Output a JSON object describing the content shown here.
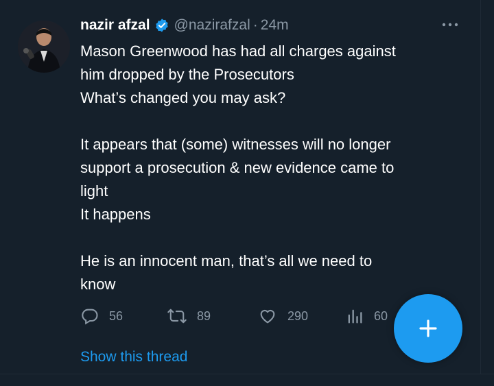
{
  "tweet": {
    "display_name": "nazir afzal",
    "handle": "@nazirafzal",
    "separator": "·",
    "time": "24m",
    "text": "Mason Greenwood has had all charges against\nhim dropped by the Prosecutors\nWhat’s changed you may ask?\n\nIt appears that (some) witnesses will no longer\nsupport a prosecution & new evidence came to\nlight\nIt happens\n\nHe is an innocent man, that’s all we need to\nknow",
    "actions": {
      "replies": "56",
      "retweets": "89",
      "likes": "290",
      "views": "60"
    },
    "show_thread": "Show this thread"
  },
  "colors": {
    "background": "#15202b",
    "accent": "#1d9bf0",
    "muted": "#8b98a5"
  },
  "icons": {
    "verified": "verified-badge-icon",
    "more": "more-options-icon",
    "reply": "reply-icon",
    "retweet": "retweet-icon",
    "like": "heart-icon",
    "views": "analytics-icon",
    "compose": "plus-icon"
  }
}
